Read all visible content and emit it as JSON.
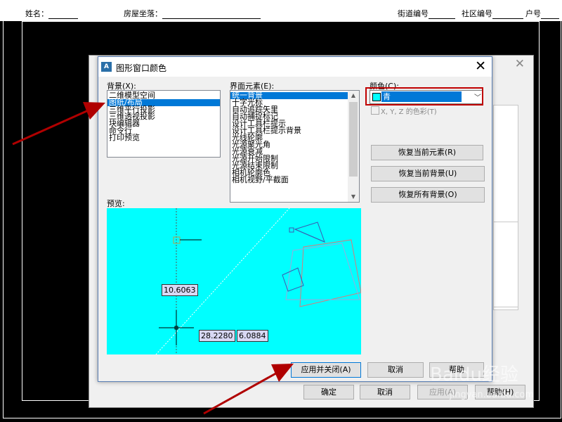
{
  "top_form": {
    "name_label": "姓名：",
    "house_label": "房屋坐落：",
    "street_label": "街道编号",
    "community_label": "社区编号",
    "unit_label": "户号"
  },
  "background_dialog": {
    "ok_button": "确定",
    "cancel_button": "取消",
    "apply_button": "应用(A)",
    "help_button": "帮助(H)"
  },
  "dialog": {
    "app_icon": "A",
    "title": "图形窗口颜色",
    "context_label": "背景(X):",
    "contexts": [
      "二维模型空间",
      "图纸/布局",
      "三维平行投影",
      "三维透视投影",
      "块编辑器",
      "命令行",
      "打印预览"
    ],
    "context_selected": 1,
    "interface_label": "界面元素(E):",
    "elements": [
      "统一背景",
      "十字光标",
      "自动追踪矢里",
      "自动捕捉标记",
      "设计工具栏提示",
      "设计工具栏提示背景",
      "光线轮廓",
      "光源聚光角",
      "光源衰减",
      "光源开始限制",
      "光源结束限制",
      "相机轮廓色",
      "相机视野/平截面"
    ],
    "element_selected": 0,
    "color_label": "颜色(C):",
    "color_value": "青",
    "color_hex": "#00ffff",
    "xyz_label": "X, Y, Z 的色彩(T)",
    "restore_element": "恢复当前元素(R)",
    "restore_context": "恢复当前背景(U)",
    "restore_all": "恢复所有背景(O)",
    "preview_label": "预览:",
    "preview_dims": [
      "10.6063",
      "28.2280",
      "6.0884"
    ],
    "apply_close": "应用并关闭(A)",
    "cancel": "取消",
    "help": "帮助"
  },
  "watermark": {
    "logo": "Baidu经验",
    "sub": "jingyan.baidu.com"
  },
  "colors": {
    "preview_bg": "#00ffff",
    "highlight": "#0078d7",
    "annotation_red": "#b00000"
  }
}
